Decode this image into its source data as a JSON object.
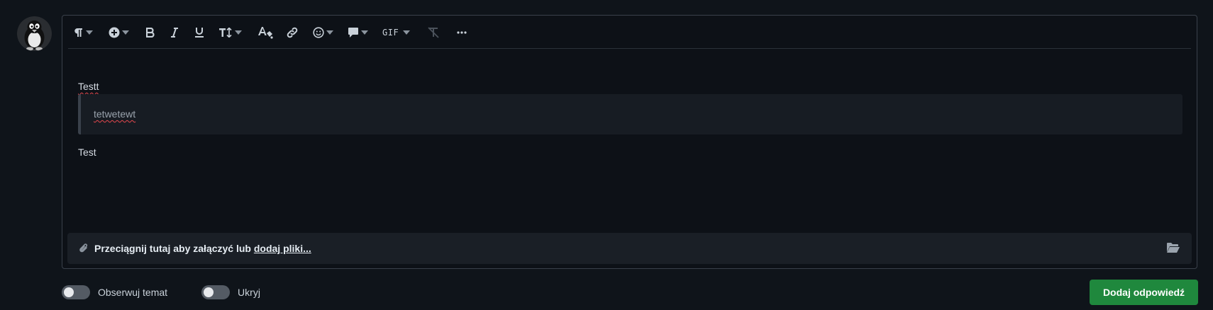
{
  "editor": {
    "toolbar": {
      "items": [
        {
          "name": "paragraph-icon",
          "has_dropdown": true
        },
        {
          "name": "insert-plus-icon",
          "has_dropdown": true
        },
        {
          "name": "bold-icon",
          "has_dropdown": false
        },
        {
          "name": "italic-icon",
          "has_dropdown": false
        },
        {
          "name": "underline-icon",
          "has_dropdown": false
        },
        {
          "name": "text-size-icon",
          "has_dropdown": true
        },
        {
          "name": "text-color-icon",
          "has_dropdown": false
        },
        {
          "name": "link-icon",
          "has_dropdown": false
        },
        {
          "name": "emoji-icon",
          "has_dropdown": true
        },
        {
          "name": "comment-icon",
          "has_dropdown": true
        },
        {
          "name": "gif-button",
          "has_dropdown": true
        },
        {
          "name": "clear-format-icon",
          "has_dropdown": false
        },
        {
          "name": "more-icon",
          "has_dropdown": false
        }
      ],
      "gif_label": "GIF"
    },
    "content": {
      "line1": "Testt",
      "quote": "tetwetewt",
      "line2": "Test"
    },
    "attachment": {
      "text": "Przeciągnij tutaj aby załączyć lub ",
      "link": "dodaj pliki..."
    }
  },
  "footer": {
    "watch_label": "Obserwuj temat",
    "hide_label": "Ukryj",
    "submit_label": "Dodaj odpowiedź"
  },
  "colors": {
    "background": "#0f141a",
    "editor_bg": "#0d1117",
    "border": "#3a414b",
    "submit_green": "#1f883d"
  }
}
